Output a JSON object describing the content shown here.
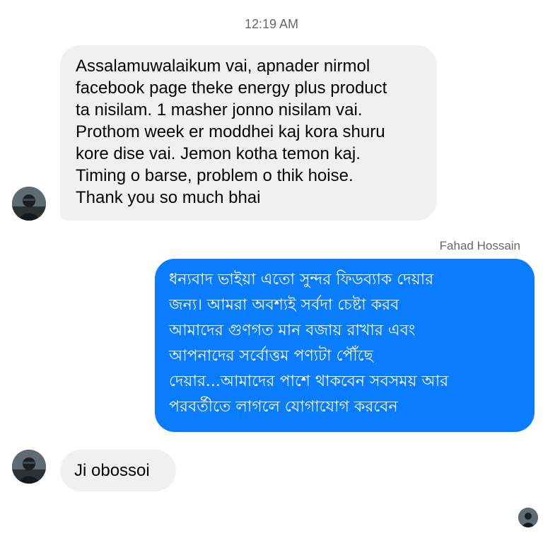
{
  "conversation": {
    "timestamp": "12:19 AM",
    "messages": [
      {
        "direction": "incoming",
        "text": "Assalamuwalaikum vai, apnader nirmol\nfacebook page theke energy plus product\nta nisilam. 1 masher jonno nisilam vai.\nProthom week er moddhei kaj kora shuru\nkore dise vai. Jemon kotha temon kaj.\nTiming o barse, problem o thik hoise.\nThank you so much bhai"
      },
      {
        "direction": "outgoing",
        "sender": "Fahad Hossain",
        "text": "ধন্যবাদ ভাইয়া এতো সুন্দর ফিডব্যাক দেয়ার\nজন্য। আমরা অবশ্যই সর্বদা চেষ্টা করব\nআমাদের গুণগত মান বজায় রাখার এবং\nআপনাদের সর্বোত্তম পণ্যটা পৌঁছে\nদেয়ার...আমাদের পাশে থাকবেন  সবসময় আর\nপরবর্তীতে লাগলে যোগাযোগ করবেন"
      },
      {
        "direction": "incoming",
        "text": "Ji obossoi"
      }
    ]
  },
  "colors": {
    "incoming_bubble": "#f0f0f0",
    "outgoing_bubble": "#0a7cff",
    "meta_text": "#65676b"
  },
  "icons": {
    "contact_avatar": "user-avatar-photo",
    "seen_indicator": "seen-avatar-icon"
  }
}
